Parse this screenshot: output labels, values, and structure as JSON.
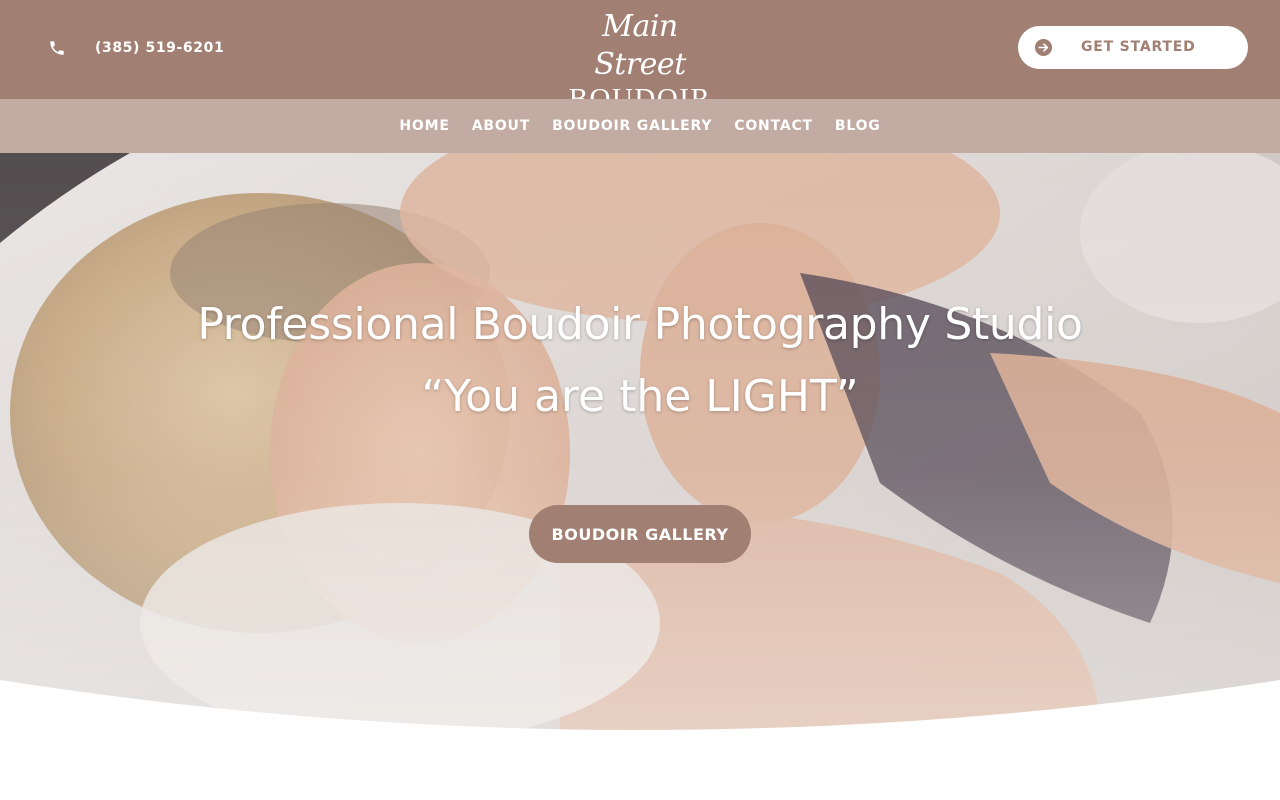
{
  "header": {
    "phone_icon": "phone-icon",
    "phone_number": "(385) 519-6201",
    "logo": {
      "script": "Main Street",
      "word": "BOUDOIR"
    },
    "cta": {
      "icon": "arrow-right-circle-icon",
      "label": "GET STARTED"
    }
  },
  "nav": {
    "items": [
      {
        "label": "HOME"
      },
      {
        "label": "ABOUT"
      },
      {
        "label": "BOUDOIR GALLERY"
      },
      {
        "label": "CONTACT"
      },
      {
        "label": "BLOG"
      }
    ]
  },
  "hero": {
    "title": "Professional Boudoir Photography Studio",
    "quote": "“You are the LIGHT”",
    "button_label": "BOUDOIR GALLERY"
  },
  "colors": {
    "brand": "#a17f73",
    "nav_background": "#c1aba3",
    "text_light": "#ffffff"
  }
}
